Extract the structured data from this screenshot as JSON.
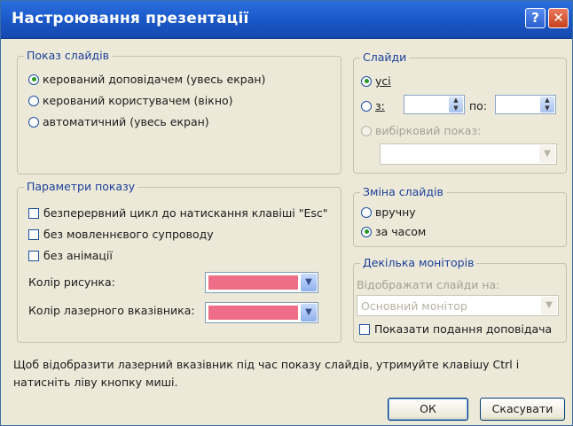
{
  "window": {
    "title": "Настроювання презентації",
    "help_symbol": "?",
    "close_symbol": "✕"
  },
  "show_type": {
    "legend": "Показ слайдів",
    "options": [
      {
        "label": "керований доповідачем (увесь екран)",
        "selected": true
      },
      {
        "label": "керований користувачем (вікно)",
        "selected": false
      },
      {
        "label": "автоматичний (увесь екран)",
        "selected": false
      }
    ]
  },
  "slides": {
    "legend": "Слайди",
    "all_label": "усі",
    "from_label": "з:",
    "to_label": "по:",
    "from_value": "",
    "to_value": "",
    "custom_show_label": "вибірковий показ:",
    "custom_show_value": "",
    "selected": "all"
  },
  "show_options": {
    "legend": "Параметри показу",
    "checkboxes": [
      {
        "label": "безперервний цикл до натискання клавіші \"Esc\"",
        "checked": false
      },
      {
        "label": "без мовленнєвого супроводу",
        "checked": false
      },
      {
        "label": "без анімації",
        "checked": false
      }
    ],
    "pen_color_label": "Колір рисунка:",
    "laser_color_label": "Колір лазерного вказівника:",
    "pen_color": "#ee6d87",
    "laser_color": "#ee6d87"
  },
  "advance": {
    "legend": "Зміна слайдів",
    "manual_label": "вручну",
    "timings_label": "за часом",
    "selected": "timings"
  },
  "monitors": {
    "legend": "Декілька моніторів",
    "display_on_label": "Відображати слайди на:",
    "display_on_value": "Основний монітор",
    "presenter_view_label": "Показати подання доповідача",
    "presenter_view_checked": false
  },
  "footer": {
    "hint": "Щоб відобразити лазерний вказівник під час показу слайдів, утримуйте клавішу Ctrl і натисніть ліву кнопку миші.",
    "ok_label": "ОК",
    "cancel_label": "Скасувати"
  }
}
